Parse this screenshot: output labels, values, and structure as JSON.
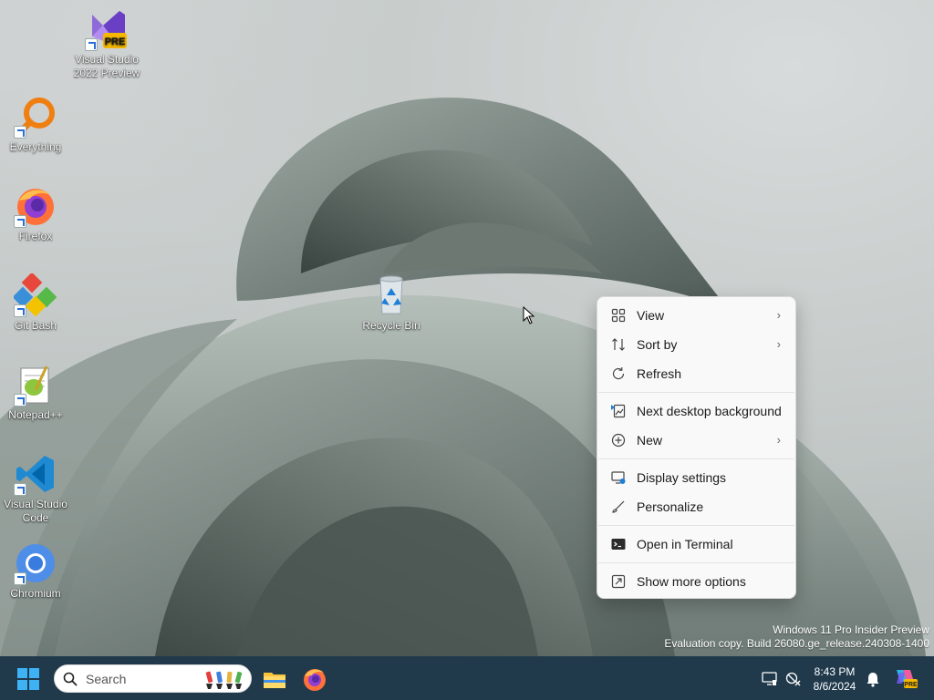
{
  "desktop": {
    "icons": [
      {
        "label": "Visual Studio 2022 Preview",
        "badge": "PRE",
        "icon": "visual-studio-preview-icon",
        "shortcut": true
      },
      {
        "label": "Everything",
        "icon": "everything-search-icon",
        "shortcut": true
      },
      {
        "label": "Firefox",
        "icon": "firefox-icon",
        "shortcut": true
      },
      {
        "label": "Git Bash",
        "icon": "git-bash-icon",
        "shortcut": true
      },
      {
        "label": "Notepad++",
        "icon": "notepad-plus-plus-icon",
        "shortcut": true
      },
      {
        "label": "Visual Studio Code",
        "icon": "vscode-icon",
        "shortcut": true
      },
      {
        "label": "Chromium",
        "icon": "chromium-icon",
        "shortcut": true
      },
      {
        "label": "Recycle Bin",
        "icon": "recycle-bin-icon",
        "shortcut": false
      }
    ]
  },
  "context_menu": {
    "items": [
      {
        "label": "View",
        "icon": "grid-view-icon",
        "submenu": true
      },
      {
        "label": "Sort by",
        "icon": "sort-icon",
        "submenu": true
      },
      {
        "label": "Refresh",
        "icon": "refresh-icon",
        "submenu": false
      },
      {
        "label": "Next desktop background",
        "icon": "next-background-icon",
        "submenu": false
      },
      {
        "label": "New",
        "icon": "plus-circle-icon",
        "submenu": true
      },
      {
        "label": "Display settings",
        "icon": "display-settings-icon",
        "submenu": false
      },
      {
        "label": "Personalize",
        "icon": "brush-icon",
        "submenu": false
      },
      {
        "label": "Open in Terminal",
        "icon": "terminal-icon",
        "submenu": false
      },
      {
        "label": "Show more options",
        "icon": "show-more-options-icon",
        "submenu": false
      }
    ]
  },
  "watermark": {
    "line1": "Windows 11 Pro Insider Preview",
    "line2": "Evaluation copy. Build 26080.ge_release.240308-1400"
  },
  "taskbar": {
    "search_placeholder": "Search",
    "apps": [
      "start-icon",
      "file-explorer-icon",
      "firefox-icon"
    ],
    "clock": {
      "time": "8:43 PM",
      "date": "8/6/2024"
    },
    "tray": [
      "display-tray-icon",
      "no-network-icon",
      "notification-bell-icon",
      "copilot-pre-icon"
    ]
  },
  "colors": {
    "taskbar": "#203a4c",
    "menu_bg": "#f9f9f9",
    "accent": "#0078d4"
  }
}
